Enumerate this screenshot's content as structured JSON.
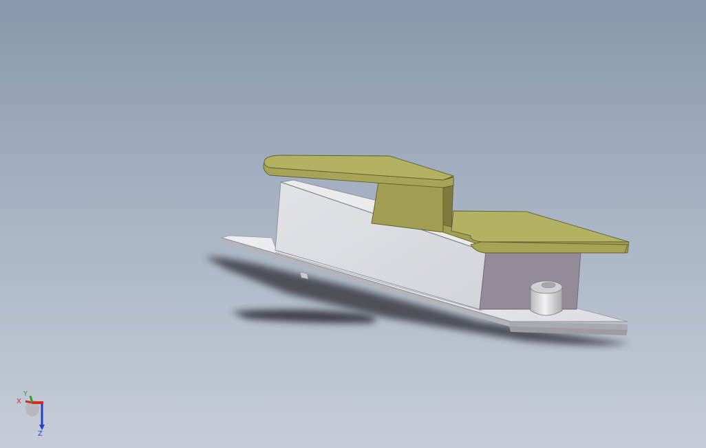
{
  "viewport": {
    "background_top": "#8897ad",
    "background_bottom": "#c6cdd8"
  },
  "model": {
    "parts": [
      "lever-arm",
      "housing-block",
      "base-plate",
      "round-post"
    ],
    "lever_color": "#a3a054",
    "housing_color": "#dcdde1",
    "housing_end_color": "#938b96",
    "plate_color": "#e4e4e8"
  },
  "triad": {
    "x_label": "X",
    "y_label": "Y",
    "z_label": "Z",
    "x_color": "#d42a2a",
    "y_color": "#2ca02c",
    "z_color": "#2240c8"
  }
}
